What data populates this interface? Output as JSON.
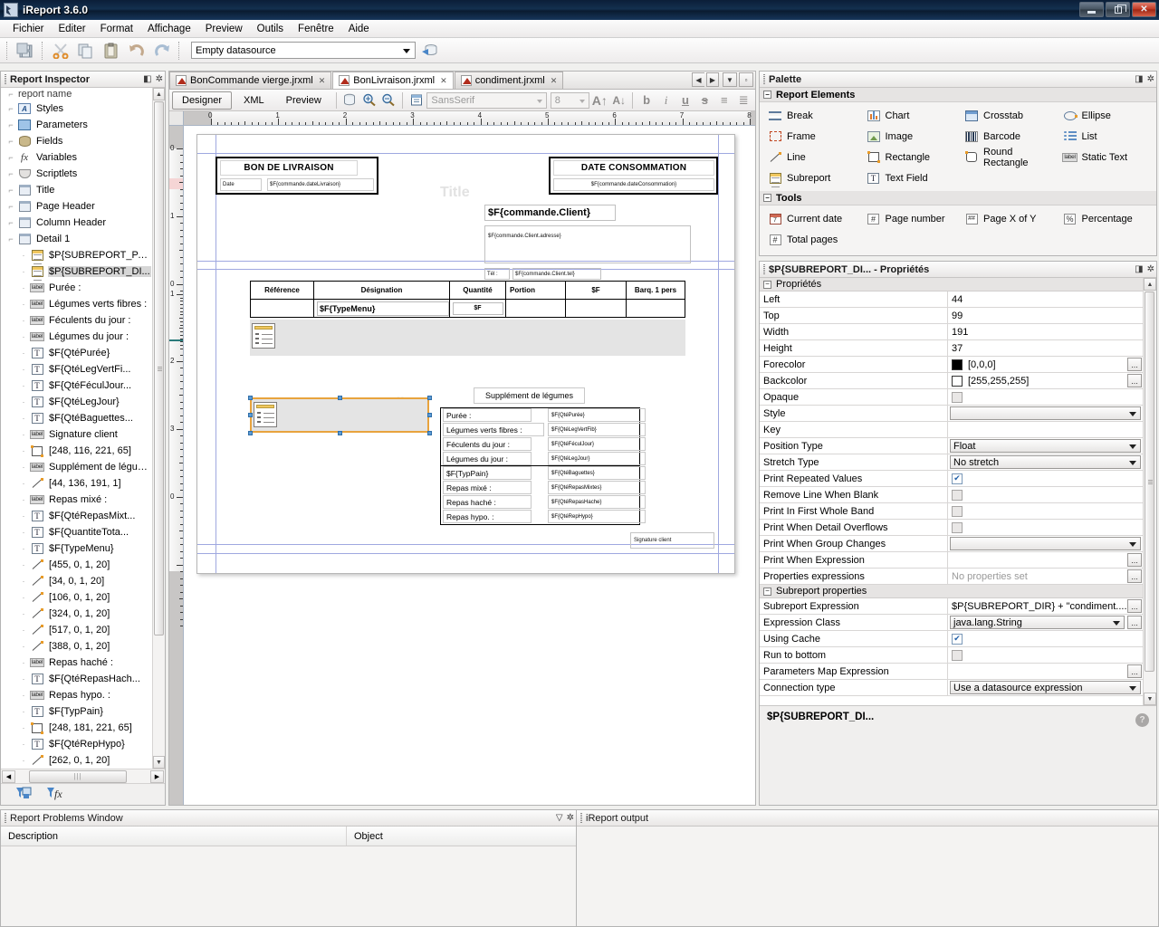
{
  "window": {
    "title": "iReport 3.6.0",
    "buttons": {
      "minimize": "minimize-button",
      "maximize": "maximize-button",
      "close": "✕"
    }
  },
  "menubar": {
    "items": [
      "Fichier",
      "Editer",
      "Format",
      "Affichage",
      "Preview",
      "Outils",
      "Fenêtre",
      "Aide"
    ]
  },
  "toolbar": {
    "datasource": {
      "value": "Empty datasource",
      "placeholder": "Empty datasource"
    },
    "icons": [
      "save-icon",
      "cut-icon",
      "copy-icon",
      "paste-icon",
      "undo-icon",
      "redo-icon",
      "datasource-run-icon"
    ]
  },
  "inspector": {
    "title": "Report Inspector",
    "root_label": "report name",
    "items": [
      {
        "label": "Styles",
        "icon": "styles-icon",
        "depth": 1
      },
      {
        "label": "Parameters",
        "icon": "parameters-icon",
        "depth": 1
      },
      {
        "label": "Fields",
        "icon": "fields-icon",
        "depth": 1
      },
      {
        "label": "Variables",
        "icon": "variables-icon",
        "depth": 1
      },
      {
        "label": "Scriptlets",
        "icon": "scriptlets-icon",
        "depth": 1
      },
      {
        "label": "Title",
        "icon": "band-icon",
        "depth": 1
      },
      {
        "label": "Page Header",
        "icon": "band-icon",
        "depth": 1
      },
      {
        "label": "Column Header",
        "icon": "band-icon",
        "depth": 1
      },
      {
        "label": "Detail 1",
        "icon": "band-icon",
        "depth": 1
      },
      {
        "label": "$P{SUBREPORT_PA...",
        "icon": "subreport-icon",
        "depth": 2
      },
      {
        "label": "$P{SUBREPORT_DI...",
        "icon": "subreport-icon",
        "depth": 2,
        "selected": true
      },
      {
        "label": "Purée :",
        "icon": "static-text-icon",
        "depth": 2
      },
      {
        "label": "Légumes verts fibres :",
        "icon": "static-text-icon",
        "depth": 2
      },
      {
        "label": "Féculents du jour :",
        "icon": "static-text-icon",
        "depth": 2
      },
      {
        "label": "Légumes du jour :",
        "icon": "static-text-icon",
        "depth": 2
      },
      {
        "label": "$F{QtéPurée}",
        "icon": "text-field-icon",
        "depth": 2
      },
      {
        "label": "$F{QtéLegVertFi...",
        "icon": "text-field-icon",
        "depth": 2
      },
      {
        "label": "$F{QtéFéculJour...",
        "icon": "text-field-icon",
        "depth": 2
      },
      {
        "label": "$F{QtéLegJour}",
        "icon": "text-field-icon",
        "depth": 2
      },
      {
        "label": "$F{QtéBaguettes...",
        "icon": "text-field-icon",
        "depth": 2
      },
      {
        "label": "Signature client",
        "icon": "static-text-icon",
        "depth": 2
      },
      {
        "label": "[248, 116, 221, 65]",
        "icon": "rectangle-icon",
        "depth": 2
      },
      {
        "label": "Supplément de légumes",
        "icon": "static-text-icon",
        "depth": 2
      },
      {
        "label": "[44, 136, 191, 1]",
        "icon": "line-icon",
        "depth": 2
      },
      {
        "label": "Repas mixé :",
        "icon": "static-text-icon",
        "depth": 2
      },
      {
        "label": "$F{QtéRepasMixt...",
        "icon": "text-field-icon",
        "depth": 2
      },
      {
        "label": "$F{QuantiteTota...",
        "icon": "text-field-icon",
        "depth": 2
      },
      {
        "label": "$F{TypeMenu}",
        "icon": "text-field-icon",
        "depth": 2
      },
      {
        "label": "[455, 0, 1, 20]",
        "icon": "line-icon",
        "depth": 2
      },
      {
        "label": "[34, 0, 1, 20]",
        "icon": "line-icon",
        "depth": 2
      },
      {
        "label": "[106, 0, 1, 20]",
        "icon": "line-icon",
        "depth": 2
      },
      {
        "label": "[324, 0, 1, 20]",
        "icon": "line-icon",
        "depth": 2
      },
      {
        "label": "[517, 0, 1, 20]",
        "icon": "line-icon",
        "depth": 2
      },
      {
        "label": "[388, 0, 1, 20]",
        "icon": "line-icon",
        "depth": 2
      },
      {
        "label": "Repas haché :",
        "icon": "static-text-icon",
        "depth": 2
      },
      {
        "label": "$F{QtéRepasHach...",
        "icon": "text-field-icon",
        "depth": 2
      },
      {
        "label": "Repas hypo. :",
        "icon": "static-text-icon",
        "depth": 2
      },
      {
        "label": "$F{TypPain}",
        "icon": "text-field-icon",
        "depth": 2
      },
      {
        "label": "[248, 181, 221, 65]",
        "icon": "rectangle-icon",
        "depth": 2
      },
      {
        "label": "$F{QtéRepHypo}",
        "icon": "text-field-icon",
        "depth": 2
      },
      {
        "label": "[262, 0, 1, 20]",
        "icon": "line-icon",
        "depth": 2
      }
    ],
    "footer_icons": [
      "filter-parameters-icon",
      "filter-variables-icon"
    ]
  },
  "editor": {
    "tabs": [
      {
        "label": "BonCommande vierge.jrxml",
        "active": false
      },
      {
        "label": "BonLivraison.jrxml",
        "active": true
      },
      {
        "label": "condiment.jrxml",
        "active": false
      }
    ],
    "view_modes": [
      {
        "label": "Designer",
        "selected": true
      },
      {
        "label": "XML",
        "selected": false
      },
      {
        "label": "Preview",
        "selected": false
      }
    ],
    "font_family": {
      "value": "SansSerif"
    },
    "font_size": {
      "value": "8"
    },
    "format_buttons": [
      "bold",
      "italic",
      "underline",
      "strikethrough",
      "align-left",
      "align-justify"
    ],
    "zoom_icons": [
      "datasource-icon",
      "zoom-in-icon",
      "zoom-out-icon",
      "fit-page-icon"
    ],
    "ruler_h_numbers": [
      "0",
      "1",
      "2",
      "3",
      "4",
      "5",
      "6",
      "7",
      "8"
    ],
    "ruler_v_numbers": [
      "0",
      "1",
      "0",
      "1",
      "2",
      "3",
      "0"
    ]
  },
  "report": {
    "bands": [
      "Title",
      "Detail 1"
    ],
    "delivery_header": "BON DE LIVRAISON",
    "date_label": "Date",
    "date_field": "$F{commande.dateLivraison}",
    "consumption_header": "DATE CONSOMMATION",
    "consumption_field": "$F{commande.dateConsommation}",
    "client_field": "$F{commande.Client}",
    "client_address_field": "$F{commande.Client.adresse}",
    "tel_label": "Tél :",
    "tel_field": "$F{commande.Client.tel}",
    "table_headers": [
      "Référence",
      "Désignation",
      "Quantité",
      "Portion",
      "$F",
      "Barq. 1 pers"
    ],
    "table_row": {
      "designation": "$F{TypeMenu}",
      "quantite": "$F"
    },
    "supplement_title": "Supplément de légumes",
    "supplement_rows_top": [
      {
        "label": "Purée :",
        "field": "$F{QtéPurée}"
      },
      {
        "label": "Légumes verts fibres :",
        "field": "$F{QtéLegVertFib}"
      },
      {
        "label": "Féculents du jour :",
        "field": "$F{QtéFéculJour}"
      },
      {
        "label": "Légumes du jour :",
        "field": "$F{QtéLegJour}"
      }
    ],
    "supplement_rows_bottom": [
      {
        "label": "$F{TypPain}",
        "field": "$F{QtéBaguettes}"
      },
      {
        "label": "Repas mixé :",
        "field": "$F{QtéRepasMixtes}"
      },
      {
        "label": "Repas haché :",
        "field": "$F{QtéRepasHache}"
      },
      {
        "label": "Repas hypo. :",
        "field": "$F{QtéRepHypo}"
      }
    ],
    "signature_label": "Signature client"
  },
  "palette": {
    "title": "Palette",
    "sections": [
      {
        "title": "Report Elements",
        "items": [
          {
            "label": "Break",
            "icon": "break-icon"
          },
          {
            "label": "Chart",
            "icon": "chart-icon"
          },
          {
            "label": "Crosstab",
            "icon": "crosstab-icon"
          },
          {
            "label": "Ellipse",
            "icon": "ellipse-icon"
          },
          {
            "label": "Frame",
            "icon": "frame-icon"
          },
          {
            "label": "Image",
            "icon": "image-icon"
          },
          {
            "label": "Barcode",
            "icon": "barcode-icon"
          },
          {
            "label": "List",
            "icon": "list-icon"
          },
          {
            "label": "Line",
            "icon": "line-icon"
          },
          {
            "label": "Rectangle",
            "icon": "rectangle-icon"
          },
          {
            "label": "Round Rectangle",
            "icon": "round-rectangle-icon"
          },
          {
            "label": "Static Text",
            "icon": "static-text-icon"
          },
          {
            "label": "Subreport",
            "icon": "subreport-icon"
          },
          {
            "label": "Text Field",
            "icon": "text-field-icon"
          }
        ]
      },
      {
        "title": "Tools",
        "items": [
          {
            "label": "Current date",
            "icon": "calendar-icon"
          },
          {
            "label": "Page number",
            "icon": "page-number-icon"
          },
          {
            "label": "Page X of Y",
            "icon": "page-x-of-y-icon"
          },
          {
            "label": "Percentage",
            "icon": "percentage-icon"
          },
          {
            "label": "Total pages",
            "icon": "total-pages-icon"
          }
        ]
      }
    ]
  },
  "properties": {
    "title": "$P{SUBREPORT_DI... - Propriétés",
    "group1": "Propriétés",
    "group2": "Subreport properties",
    "rows": [
      {
        "name": "Left",
        "value": "44",
        "type": "text"
      },
      {
        "name": "Top",
        "value": "99",
        "type": "text"
      },
      {
        "name": "Width",
        "value": "191",
        "type": "text"
      },
      {
        "name": "Height",
        "value": "37",
        "type": "text"
      },
      {
        "name": "Forecolor",
        "value": "[0,0,0]",
        "type": "color",
        "color": "#000000",
        "dots": true
      },
      {
        "name": "Backcolor",
        "value": "[255,255,255]",
        "type": "color",
        "color": "#ffffff",
        "dots": true
      },
      {
        "name": "Opaque",
        "value": "",
        "type": "checkbox",
        "checked": false,
        "dim": true
      },
      {
        "name": "Style",
        "value": "",
        "type": "dropdown"
      },
      {
        "name": "Key",
        "value": "",
        "type": "text"
      },
      {
        "name": "Position Type",
        "value": "Float",
        "type": "dropdown"
      },
      {
        "name": "Stretch Type",
        "value": "No stretch",
        "type": "dropdown"
      },
      {
        "name": "Print Repeated Values",
        "value": "",
        "type": "checkbox",
        "checked": true
      },
      {
        "name": "Remove Line When Blank",
        "value": "",
        "type": "checkbox",
        "checked": false,
        "dim": true
      },
      {
        "name": "Print In First Whole Band",
        "value": "",
        "type": "checkbox",
        "checked": false,
        "dim": true
      },
      {
        "name": "Print When Detail Overflows",
        "value": "",
        "type": "checkbox",
        "checked": false,
        "dim": true
      },
      {
        "name": "Print When Group Changes",
        "value": "",
        "type": "dropdown"
      },
      {
        "name": "Print When Expression",
        "value": "",
        "type": "text",
        "dots": true
      },
      {
        "name": "Properties expressions",
        "value": "No properties set",
        "type": "muted",
        "dots": true
      }
    ],
    "rows2": [
      {
        "name": "Subreport Expression",
        "value": "$P{SUBREPORT_DIR} + \"condiment....",
        "type": "text",
        "dots": true
      },
      {
        "name": "Expression Class",
        "value": "java.lang.String",
        "type": "dropdown",
        "dots": true
      },
      {
        "name": "Using Cache",
        "value": "",
        "type": "checkbox",
        "checked": true
      },
      {
        "name": "Run to bottom",
        "value": "",
        "type": "checkbox",
        "checked": false,
        "dim": true
      },
      {
        "name": "Parameters Map Expression",
        "value": "",
        "type": "text",
        "dots": true
      },
      {
        "name": "Connection type",
        "value": "Use a datasource expression",
        "type": "dropdown"
      }
    ],
    "footer_label": "$P{SUBREPORT_DI...",
    "help_glyph": "?"
  },
  "bottom": {
    "problems": {
      "title": "Report Problems Window",
      "columns": [
        "Description",
        "Object"
      ]
    },
    "output": {
      "title": "iReport output"
    }
  }
}
